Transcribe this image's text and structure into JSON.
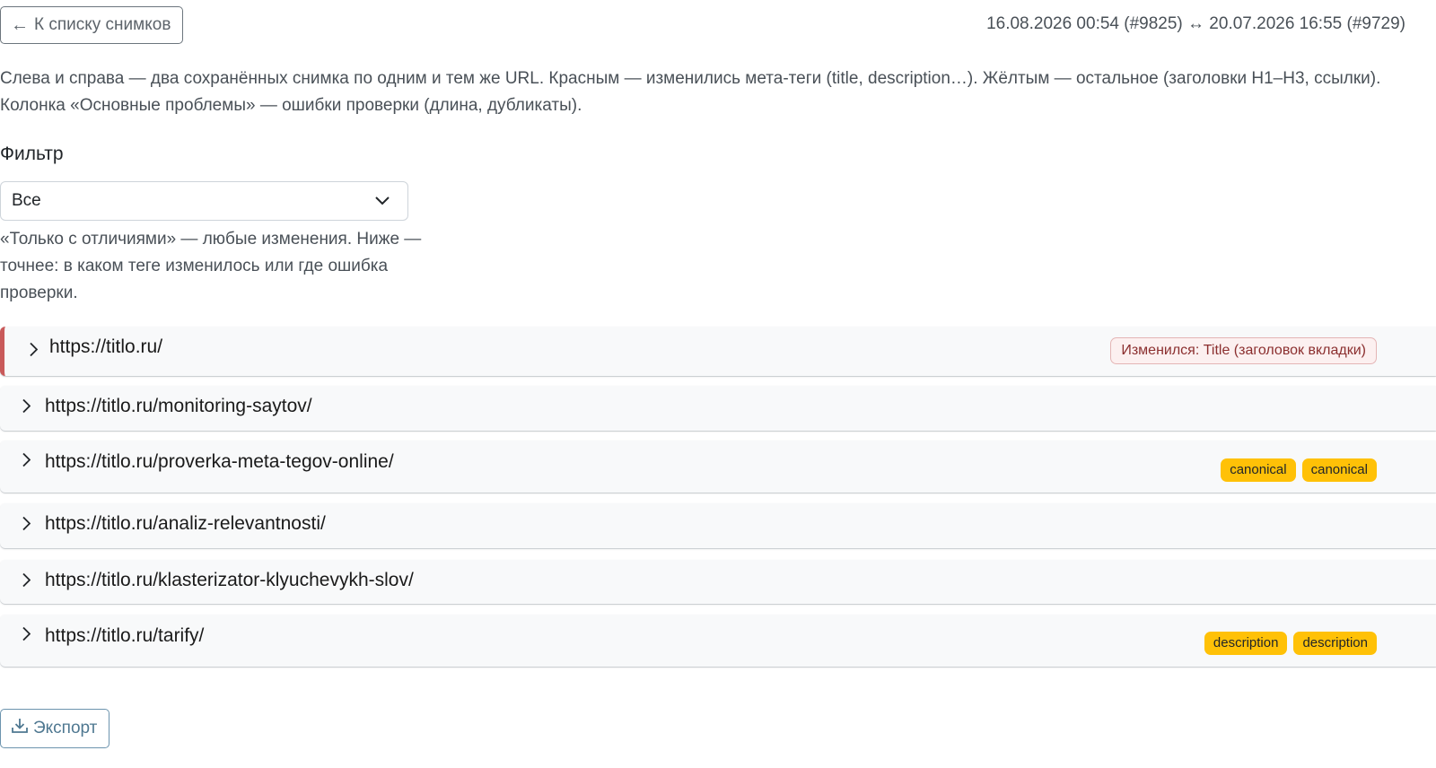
{
  "header": {
    "back_label": "К списку снимков",
    "compare_info": "16.08.2026 00:54 (#9825) ↔ 20.07.2026 16:55 (#9729)"
  },
  "intro": {
    "line1": "Слева и справа — два сохранённых снимка по одним и тем же URL. Красным — изменились мета-теги (title, description…). Жёлтым — остальное (заголовки H1–H3, ссылки).",
    "line2": "Колонка «Основные проблемы» — ошибки проверки (длина, дубликаты)."
  },
  "filter": {
    "label": "Фильтр",
    "selected": "Все",
    "help": "«Только с отличиями» — любые изменения. Ниже — точнее: в каком теге изменилось или где ошибка проверки."
  },
  "rows": [
    {
      "url": "https://titlo.ru/",
      "badges": [],
      "changed_badge": "Изменился: Title (заголовок вкладки)"
    },
    {
      "url": "https://titlo.ru/monitoring-saytov/",
      "badges": []
    },
    {
      "url": "https://titlo.ru/proverka-meta-tegov-online/",
      "badges": [
        "canonical",
        "canonical"
      ]
    },
    {
      "url": "https://titlo.ru/analiz-relevantnosti/",
      "badges": []
    },
    {
      "url": "https://titlo.ru/klasterizator-klyuchevykh-slov/",
      "badges": []
    },
    {
      "url": "https://titlo.ru/tarify/",
      "badges": [
        "description",
        "description"
      ]
    }
  ],
  "export": {
    "label": "Экспорт"
  },
  "colors": {
    "changed_accent": "#c95a5a",
    "badge_yellow": "#ffc107"
  }
}
